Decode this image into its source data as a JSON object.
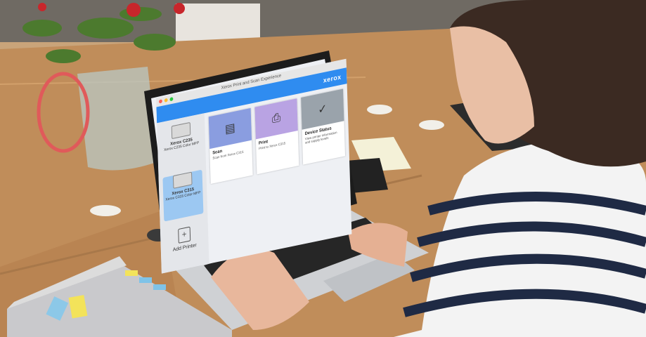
{
  "window": {
    "title": "Xerox Print and Scan Experience"
  },
  "brand": {
    "label": "xerox"
  },
  "printers": [
    {
      "name": "Xerox C235",
      "desc": "Xerox C235 Color MFP",
      "selected": false
    },
    {
      "name": "Xerox C315",
      "desc": "Xerox C315 Color MFP",
      "selected": true
    }
  ],
  "add_printer": {
    "label": "Add Printer"
  },
  "tiles": [
    {
      "title": "Scan",
      "subtitle": "Scan from Xerox C315",
      "color": "#8a9de0",
      "icon": "scanner-icon"
    },
    {
      "title": "Print",
      "subtitle": "Print to Xerox C315",
      "color": "#b9a3e3",
      "icon": "printer-icon"
    },
    {
      "title": "Device Status",
      "subtitle": "View printer information and supply levels",
      "color": "#9aa3ab",
      "icon": "checkmark-icon"
    }
  ],
  "colors": {
    "brand_blue": "#2f8cf0",
    "selected_printer": "#9cc8f2"
  }
}
